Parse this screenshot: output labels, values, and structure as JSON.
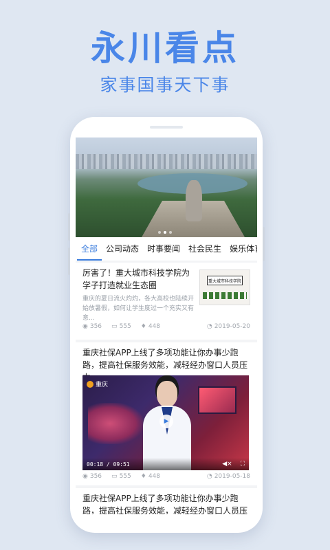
{
  "promo": {
    "headline": "永川看点",
    "tagline": "家事国事天下事"
  },
  "banner": {
    "dots_total": 3,
    "active_dot": 1
  },
  "tabs": [
    {
      "label": "全部",
      "active": true
    },
    {
      "label": "公司动态",
      "active": false
    },
    {
      "label": "时事要闻",
      "active": false
    },
    {
      "label": "社会民生",
      "active": false
    },
    {
      "label": "娱乐体育",
      "active": false
    }
  ],
  "articles": [
    {
      "title": "厉害了！重大城市科技学院为学子打造就业生态圈",
      "snippet": "重庆的夏日流火灼灼，各大高校也陆续开始放暑假，如何让学生度过一个充实又有意...",
      "views": "356",
      "comments": "555",
      "likes": "448",
      "date": "2019-05-20",
      "thumb_sign": "重大城市科技学院"
    },
    {
      "title": "重庆社保APP上线了多项功能让你办事少跑路，提高社保服务效能，减轻经办窗口人员压力",
      "video_logo": "重庆",
      "video_time": "00:18 / 09:51",
      "views": "356",
      "comments": "555",
      "likes": "448",
      "date": "2019-05-18"
    },
    {
      "title": "重庆社保APP上线了多项功能让你办事少跑路，提高社保服务效能，减轻经办窗口人员压力"
    }
  ],
  "colors": {
    "accent": "#3b7ddd",
    "headline": "#4a86e8",
    "background": "#dfe7f2"
  },
  "icons": {
    "views": "eye-icon",
    "comments": "comment-icon",
    "likes": "thumbs-up-icon",
    "date": "clock-icon",
    "play": "play-icon",
    "mute": "mute-icon",
    "fullscreen": "fullscreen-icon"
  }
}
